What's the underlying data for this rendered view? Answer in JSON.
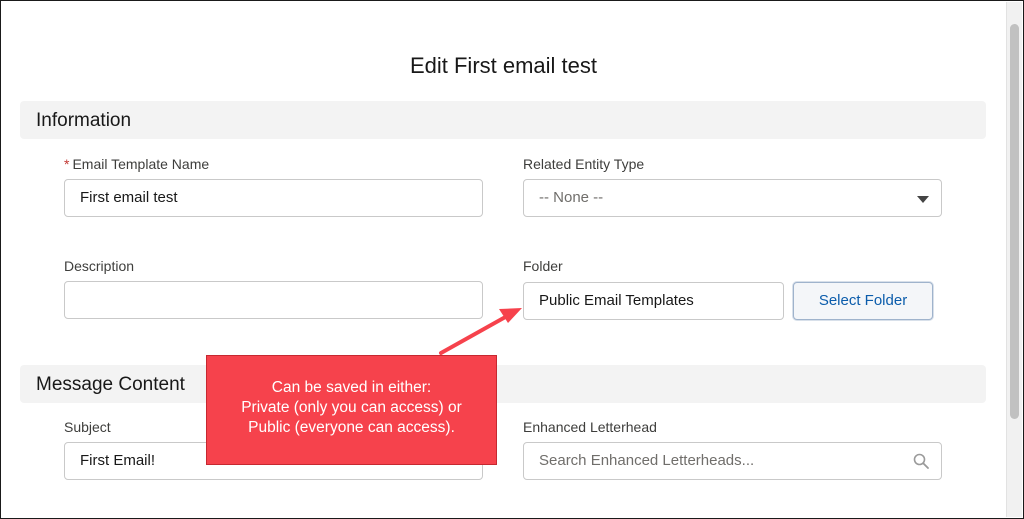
{
  "page": {
    "title": "Edit First email test"
  },
  "sections": {
    "information": "Information",
    "message_content": "Message Content"
  },
  "fields": {
    "template_name": {
      "required_marker": "*",
      "label": "Email Template Name",
      "value": "First email test"
    },
    "related_entity": {
      "label": "Related Entity Type",
      "value": "-- None --"
    },
    "description": {
      "label": "Description",
      "value": ""
    },
    "folder": {
      "label": "Folder",
      "value": "Public Email Templates",
      "button": "Select Folder"
    },
    "subject": {
      "label": "Subject",
      "value": "First Email!"
    },
    "letterhead": {
      "label": "Enhanced Letterhead",
      "placeholder": "Search Enhanced Letterheads..."
    }
  },
  "callout": {
    "lines": [
      "Can be saved in either:",
      "Private (only you can access) or",
      "Public (everyone can access)."
    ],
    "color": "#f6424c"
  },
  "icons": {
    "select": "chevron-down-icon",
    "search": "search-icon"
  }
}
